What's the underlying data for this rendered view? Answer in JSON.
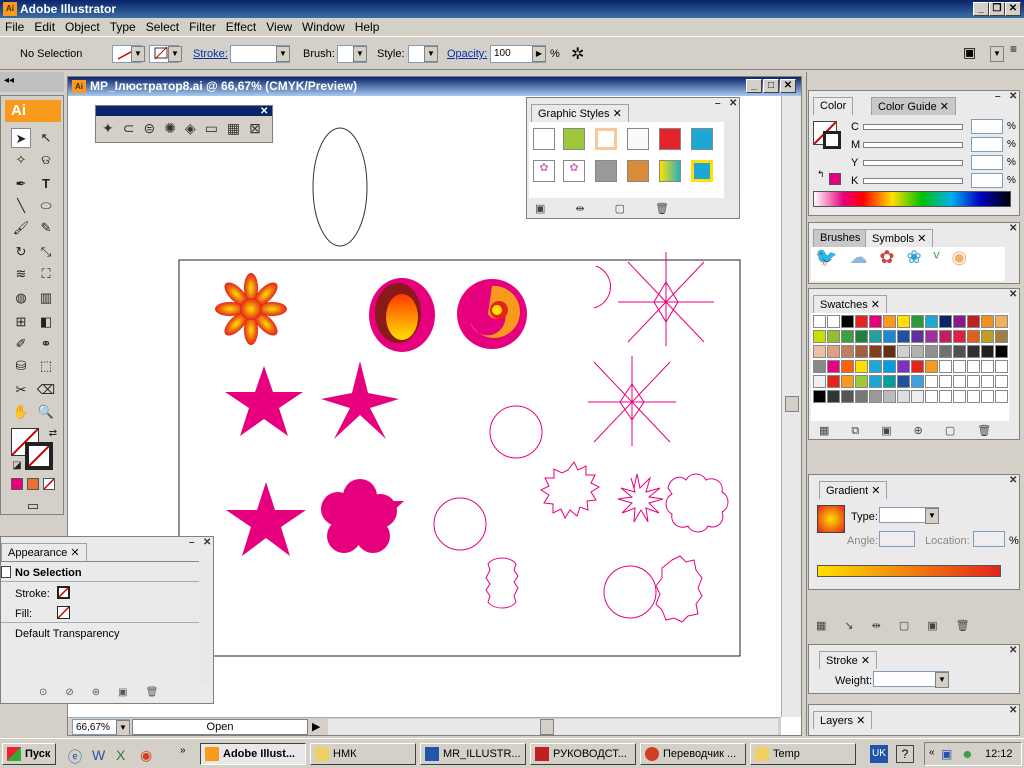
{
  "app": {
    "title": "Adobe Illustrator",
    "icon_label": "Ai"
  },
  "menu": [
    "File",
    "Edit",
    "Object",
    "Type",
    "Select",
    "Filter",
    "Effect",
    "View",
    "Window",
    "Help"
  ],
  "control_bar": {
    "selection": "No Selection",
    "stroke_label": "Stroke:",
    "brush_label": "Brush:",
    "style_label": "Style:",
    "opacity_label": "Opacity:",
    "opacity_value": "100",
    "percent": "%"
  },
  "document": {
    "title": "MP_Ілюстратор8.ai @ 66,67% (CMYK/Preview)",
    "zoom": "66,67%",
    "status": "Open"
  },
  "graphic_styles": {
    "tab": "Graphic Styles"
  },
  "color_panel": {
    "tabs": [
      "Color",
      "Color Guide"
    ],
    "channels": [
      "C",
      "M",
      "Y",
      "K"
    ],
    "percent": "%"
  },
  "brushes_panel": {
    "tabs": [
      "Brushes",
      "Symbols"
    ]
  },
  "swatches_panel": {
    "tab": "Swatches"
  },
  "gradient_panel": {
    "tab": "Gradient",
    "type_label": "Type:",
    "angle_label": "Angle:",
    "location_label": "Location:",
    "percent": "%"
  },
  "stroke_panel": {
    "tab": "Stroke",
    "weight_label": "Weight:"
  },
  "layers_panel": {
    "tab": "Layers"
  },
  "appearance_panel": {
    "tab": "Appearance",
    "header": "No Selection",
    "rows": [
      "Stroke:",
      "Fill:",
      "Default Transparency"
    ]
  },
  "taskbar": {
    "start": "Пуск",
    "buttons": [
      "Adobe Illust...",
      "НМК",
      "MR_ILLUSTR...",
      "РУКОВОДСТ...",
      "Переводчик ...",
      "Temp"
    ],
    "lang": "UK",
    "clock": "12:12"
  },
  "colors": {
    "accent": "#e6007e",
    "title_blue": "#0a246a",
    "ai_orange": "#f79a1e"
  }
}
